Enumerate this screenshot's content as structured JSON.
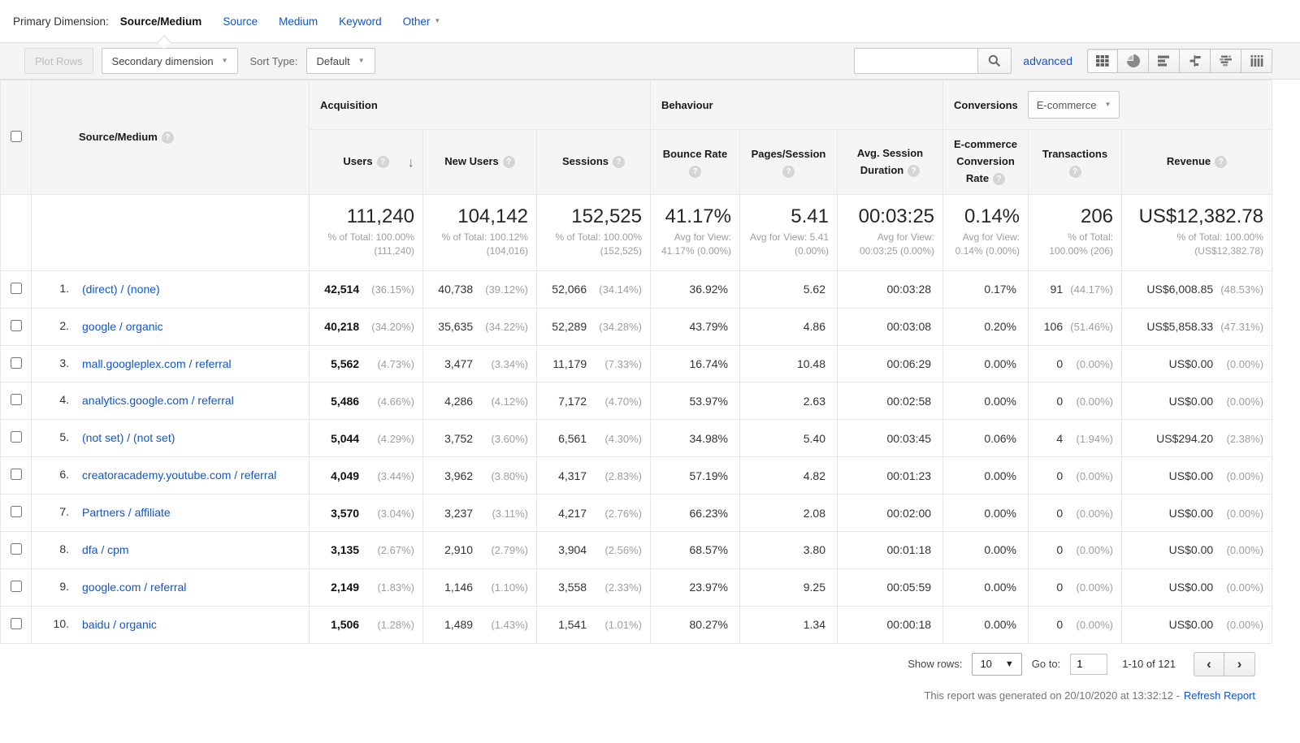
{
  "icons": {
    "help": "?",
    "sort_desc": "↓",
    "caret_down": "▼",
    "select_caret": "▼",
    "prev": "‹",
    "next": "›"
  },
  "primary_dimension": {
    "label": "Primary Dimension:",
    "selected": "Source/Medium",
    "links": [
      "Source",
      "Medium",
      "Keyword"
    ],
    "other": "Other"
  },
  "toolbar": {
    "plot_rows": "Plot Rows",
    "secondary_dimension": "Secondary dimension",
    "sort_type_label": "Sort Type:",
    "sort_type_value": "Default",
    "search_value": "",
    "advanced": "advanced"
  },
  "table": {
    "dimension_column": "Source/Medium",
    "groups": {
      "acquisition": "Acquisition",
      "behaviour": "Behaviour",
      "conversions": "Conversions",
      "conversions_dropdown": "E-commerce"
    },
    "columns": {
      "users": "Users",
      "new_users": "New Users",
      "sessions": "Sessions",
      "bounce_rate": "Bounce Rate",
      "pages_session": "Pages/Session",
      "avg_session_duration": "Avg. Session Duration",
      "ecommerce_conversion_rate": "E-commerce Conversion Rate",
      "transactions": "Transactions",
      "revenue": "Revenue"
    },
    "totals": {
      "users": "111,240",
      "users_sub": "% of Total: 100.00% (111,240)",
      "new_users": "104,142",
      "new_users_sub": "% of Total: 100.12% (104,016)",
      "sessions": "152,525",
      "sessions_sub": "% of Total: 100.00% (152,525)",
      "bounce_rate": "41.17%",
      "bounce_rate_sub": "Avg for View: 41.17% (0.00%)",
      "pages_session": "5.41",
      "pages_session_sub": "Avg for View: 5.41 (0.00%)",
      "avg_session_duration": "00:03:25",
      "avg_session_duration_sub": "Avg for View: 00:03:25 (0.00%)",
      "ecommerce_conversion_rate": "0.14%",
      "ecommerce_conversion_rate_sub": "Avg for View: 0.14% (0.00%)",
      "transactions": "206",
      "transactions_sub": "% of Total: 100.00% (206)",
      "revenue": "US$12,382.78",
      "revenue_sub": "% of Total: 100.00% (US$12,382.78)"
    },
    "rows": [
      {
        "rank": "1.",
        "source": "(direct) / (none)",
        "users": "42,514",
        "users_pct": "(36.15%)",
        "new_users": "40,738",
        "new_users_pct": "(39.12%)",
        "sessions": "52,066",
        "sessions_pct": "(34.14%)",
        "bounce_rate": "36.92%",
        "pages_session": "5.62",
        "avg_session_duration": "00:03:28",
        "ecr": "0.17%",
        "transactions": "91",
        "transactions_pct": "(44.17%)",
        "revenue": "US$6,008.85",
        "revenue_pct": "(48.53%)"
      },
      {
        "rank": "2.",
        "source": "google / organic",
        "users": "40,218",
        "users_pct": "(34.20%)",
        "new_users": "35,635",
        "new_users_pct": "(34.22%)",
        "sessions": "52,289",
        "sessions_pct": "(34.28%)",
        "bounce_rate": "43.79%",
        "pages_session": "4.86",
        "avg_session_duration": "00:03:08",
        "ecr": "0.20%",
        "transactions": "106",
        "transactions_pct": "(51.46%)",
        "revenue": "US$5,858.33",
        "revenue_pct": "(47.31%)"
      },
      {
        "rank": "3.",
        "source": "mall.googleplex.com / referral",
        "users": "5,562",
        "users_pct": "(4.73%)",
        "new_users": "3,477",
        "new_users_pct": "(3.34%)",
        "sessions": "11,179",
        "sessions_pct": "(7.33%)",
        "bounce_rate": "16.74%",
        "pages_session": "10.48",
        "avg_session_duration": "00:06:29",
        "ecr": "0.00%",
        "transactions": "0",
        "transactions_pct": "(0.00%)",
        "revenue": "US$0.00",
        "revenue_pct": "(0.00%)"
      },
      {
        "rank": "4.",
        "source": "analytics.google.com / referral",
        "users": "5,486",
        "users_pct": "(4.66%)",
        "new_users": "4,286",
        "new_users_pct": "(4.12%)",
        "sessions": "7,172",
        "sessions_pct": "(4.70%)",
        "bounce_rate": "53.97%",
        "pages_session": "2.63",
        "avg_session_duration": "00:02:58",
        "ecr": "0.00%",
        "transactions": "0",
        "transactions_pct": "(0.00%)",
        "revenue": "US$0.00",
        "revenue_pct": "(0.00%)"
      },
      {
        "rank": "5.",
        "source": "(not set) / (not set)",
        "users": "5,044",
        "users_pct": "(4.29%)",
        "new_users": "3,752",
        "new_users_pct": "(3.60%)",
        "sessions": "6,561",
        "sessions_pct": "(4.30%)",
        "bounce_rate": "34.98%",
        "pages_session": "5.40",
        "avg_session_duration": "00:03:45",
        "ecr": "0.06%",
        "transactions": "4",
        "transactions_pct": "(1.94%)",
        "revenue": "US$294.20",
        "revenue_pct": "(2.38%)"
      },
      {
        "rank": "6.",
        "source": "creatoracademy.youtube.com / referral",
        "users": "4,049",
        "users_pct": "(3.44%)",
        "new_users": "3,962",
        "new_users_pct": "(3.80%)",
        "sessions": "4,317",
        "sessions_pct": "(2.83%)",
        "bounce_rate": "57.19%",
        "pages_session": "4.82",
        "avg_session_duration": "00:01:23",
        "ecr": "0.00%",
        "transactions": "0",
        "transactions_pct": "(0.00%)",
        "revenue": "US$0.00",
        "revenue_pct": "(0.00%)"
      },
      {
        "rank": "7.",
        "source": "Partners / affiliate",
        "users": "3,570",
        "users_pct": "(3.04%)",
        "new_users": "3,237",
        "new_users_pct": "(3.11%)",
        "sessions": "4,217",
        "sessions_pct": "(2.76%)",
        "bounce_rate": "66.23%",
        "pages_session": "2.08",
        "avg_session_duration": "00:02:00",
        "ecr": "0.00%",
        "transactions": "0",
        "transactions_pct": "(0.00%)",
        "revenue": "US$0.00",
        "revenue_pct": "(0.00%)"
      },
      {
        "rank": "8.",
        "source": "dfa / cpm",
        "users": "3,135",
        "users_pct": "(2.67%)",
        "new_users": "2,910",
        "new_users_pct": "(2.79%)",
        "sessions": "3,904",
        "sessions_pct": "(2.56%)",
        "bounce_rate": "68.57%",
        "pages_session": "3.80",
        "avg_session_duration": "00:01:18",
        "ecr": "0.00%",
        "transactions": "0",
        "transactions_pct": "(0.00%)",
        "revenue": "US$0.00",
        "revenue_pct": "(0.00%)"
      },
      {
        "rank": "9.",
        "source": "google.com / referral",
        "users": "2,149",
        "users_pct": "(1.83%)",
        "new_users": "1,146",
        "new_users_pct": "(1.10%)",
        "sessions": "3,558",
        "sessions_pct": "(2.33%)",
        "bounce_rate": "23.97%",
        "pages_session": "9.25",
        "avg_session_duration": "00:05:59",
        "ecr": "0.00%",
        "transactions": "0",
        "transactions_pct": "(0.00%)",
        "revenue": "US$0.00",
        "revenue_pct": "(0.00%)"
      },
      {
        "rank": "10.",
        "source": "baidu / organic",
        "users": "1,506",
        "users_pct": "(1.28%)",
        "new_users": "1,489",
        "new_users_pct": "(1.43%)",
        "sessions": "1,541",
        "sessions_pct": "(1.01%)",
        "bounce_rate": "80.27%",
        "pages_session": "1.34",
        "avg_session_duration": "00:00:18",
        "ecr": "0.00%",
        "transactions": "0",
        "transactions_pct": "(0.00%)",
        "revenue": "US$0.00",
        "revenue_pct": "(0.00%)"
      }
    ]
  },
  "pagination": {
    "show_rows_label": "Show rows:",
    "show_rows_value": "10",
    "goto_label": "Go to:",
    "goto_value": "1",
    "range": "1-10 of 121"
  },
  "footer": {
    "generated_text": "This report was generated on 20/10/2020 at 13:32:12 -",
    "refresh_link": "Refresh Report"
  }
}
